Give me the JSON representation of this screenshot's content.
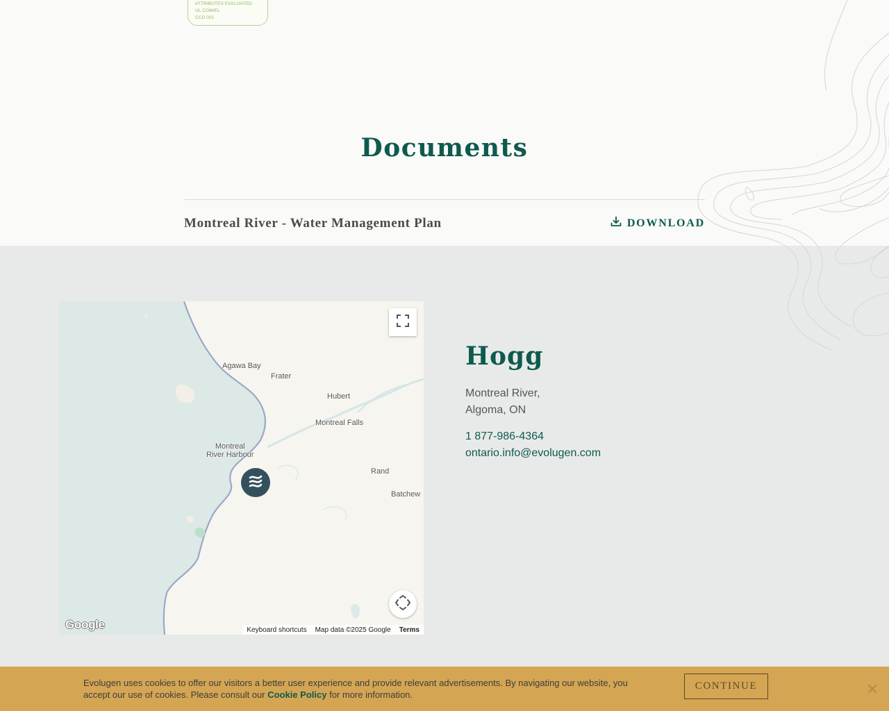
{
  "certification": {
    "lines": [
      "ATTRIBUTES EVALUATED:",
      "UL.COM/EL",
      "CCD 001"
    ]
  },
  "documents": {
    "title": "Documents",
    "items": [
      {
        "name": "Montreal River - Water Management Plan",
        "action_label": "DOWNLOAD"
      }
    ]
  },
  "map": {
    "places": [
      "Agawa Bay",
      "Frater",
      "Hubert",
      "Montreal Falls",
      "Montreal\nRiver Harbour",
      "Rand",
      "Batchew"
    ],
    "logo_text": "Google",
    "attribution": {
      "shortcuts": "Keyboard shortcuts",
      "data": "Map data ©2025 Google",
      "terms": "Terms"
    }
  },
  "location": {
    "name": "Hogg",
    "address_line1": "Montreal River,",
    "address_line2": "Algoma, ON",
    "phone": "1 877-986-4364",
    "email": "ontario.info@evolugen.com"
  },
  "cookie_banner": {
    "text_before": "Evolugen uses cookies to offer our visitors a better user experience and provide relevant advertisements. By navigating our website, you accept our use of cookies. Please consult our ",
    "link_label": "Cookie Policy",
    "text_after": " for more information.",
    "button_label": "CONTINUE"
  },
  "colors": {
    "brand_green": "#0e5a4e",
    "cookie_bg": "#d4a553",
    "water": "#dde9e7",
    "map_pin": "#34505d"
  }
}
